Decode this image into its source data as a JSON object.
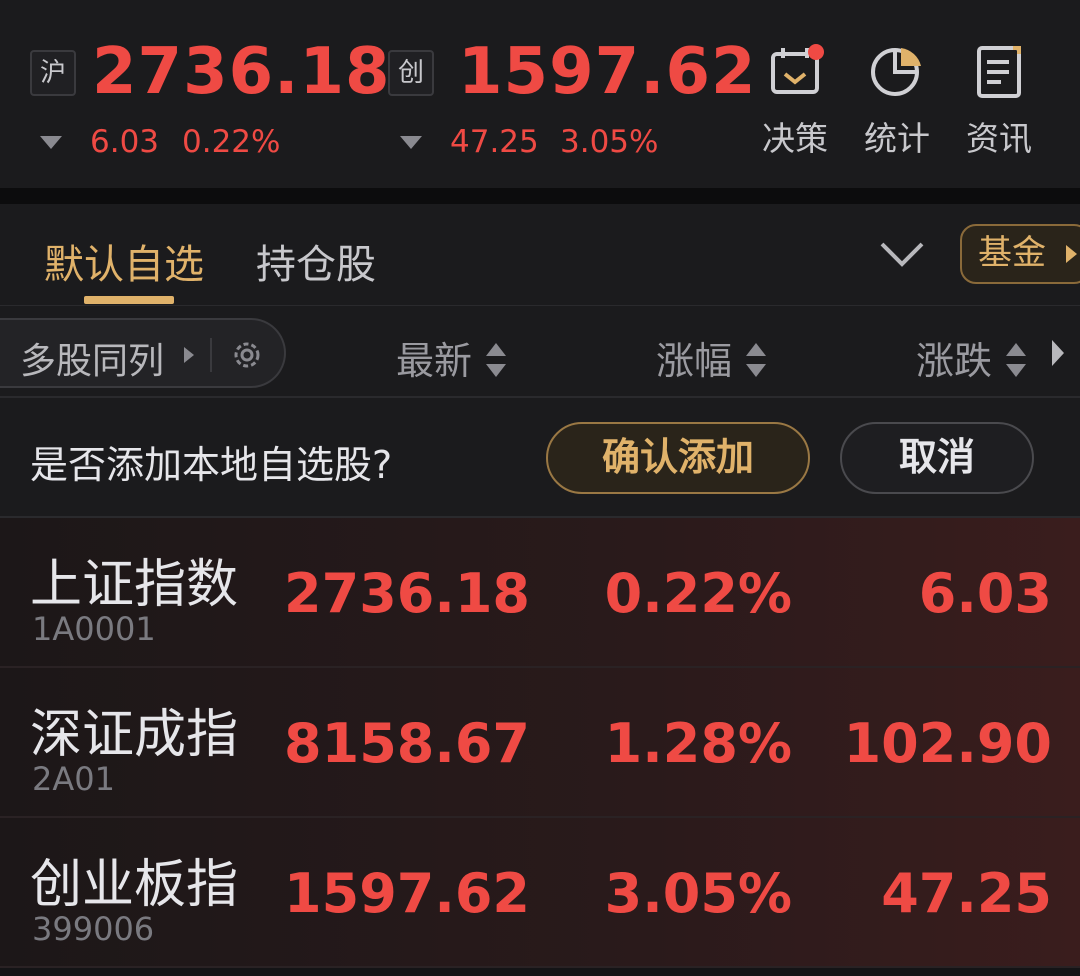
{
  "indices": [
    {
      "badge": "沪",
      "value": "2736.18",
      "change": "6.03",
      "percent": "0.22%"
    },
    {
      "badge": "创",
      "value": "1597.62",
      "change": "47.25",
      "percent": "3.05%"
    }
  ],
  "tools": [
    {
      "label": "决策",
      "icon": "decision-calendar-icon",
      "has_dot": true
    },
    {
      "label": "统计",
      "icon": "pie-chart-icon",
      "has_dot": false
    },
    {
      "label": "资讯",
      "icon": "news-document-icon",
      "has_dot": false
    }
  ],
  "tabs": {
    "active": "默认自选",
    "other": "持仓股",
    "fund_chip": "基金"
  },
  "columns": {
    "multi_list": "多股同列",
    "latest": "最新",
    "change_pct": "涨幅",
    "change": "涨跌"
  },
  "prompt": {
    "text": "是否添加本地自选股?",
    "confirm": "确认添加",
    "cancel": "取消"
  },
  "stocks": [
    {
      "name": "上证指数",
      "code": "1A0001",
      "latest": "2736.18",
      "change_pct": "0.22%",
      "change": "6.03"
    },
    {
      "name": "深证成指",
      "code": "2A01",
      "latest": "8158.67",
      "change_pct": "1.28%",
      "change": "102.90"
    },
    {
      "name": "创业板指",
      "code": "399006",
      "latest": "1597.62",
      "change_pct": "3.05%",
      "change": "47.25"
    }
  ],
  "colors": {
    "up": "#ef4a44",
    "accent_gold": "#e0b26a",
    "background": "#141416"
  }
}
